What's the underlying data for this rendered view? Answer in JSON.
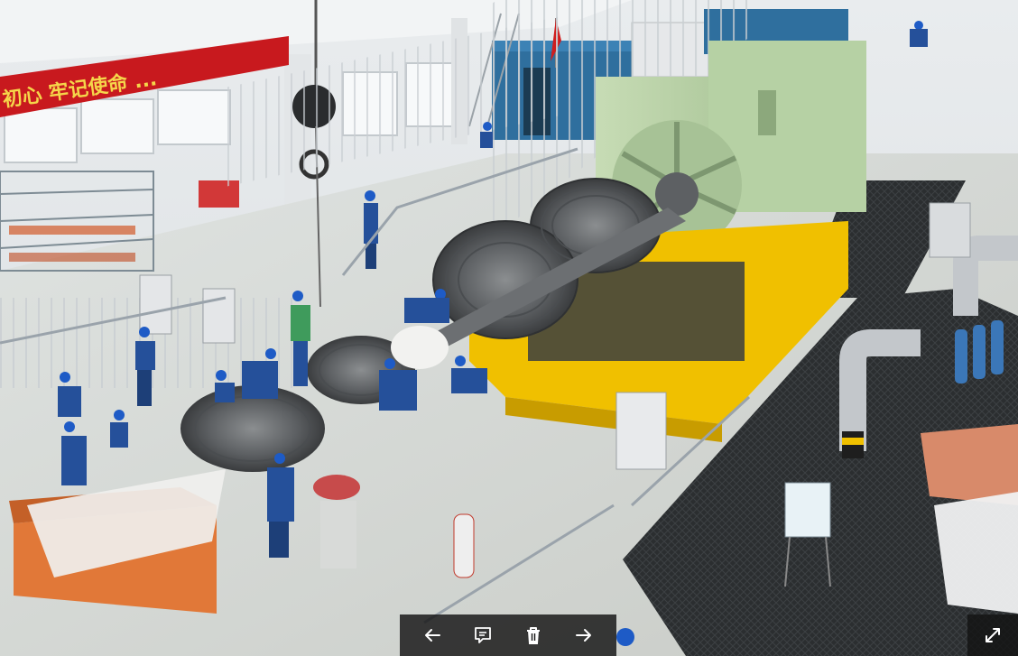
{
  "viewer": {
    "photo_banner_text": "初心 牢记使命 ...",
    "toolbar": {
      "prev_icon": "arrow-left-icon",
      "comment_icon": "comment-icon",
      "delete_icon": "trash-icon",
      "next_icon": "arrow-right-icon"
    },
    "fullscreen_icon": "expand-icon"
  },
  "colors": {
    "toolbar_bg": "#141414",
    "icon": "#ffffff",
    "banner_red": "#c8191e",
    "banner_text": "#f5d64a",
    "machine_green": "#b9d4a8",
    "safety_yellow": "#f0c000",
    "container_blue": "#2f6f9e"
  }
}
